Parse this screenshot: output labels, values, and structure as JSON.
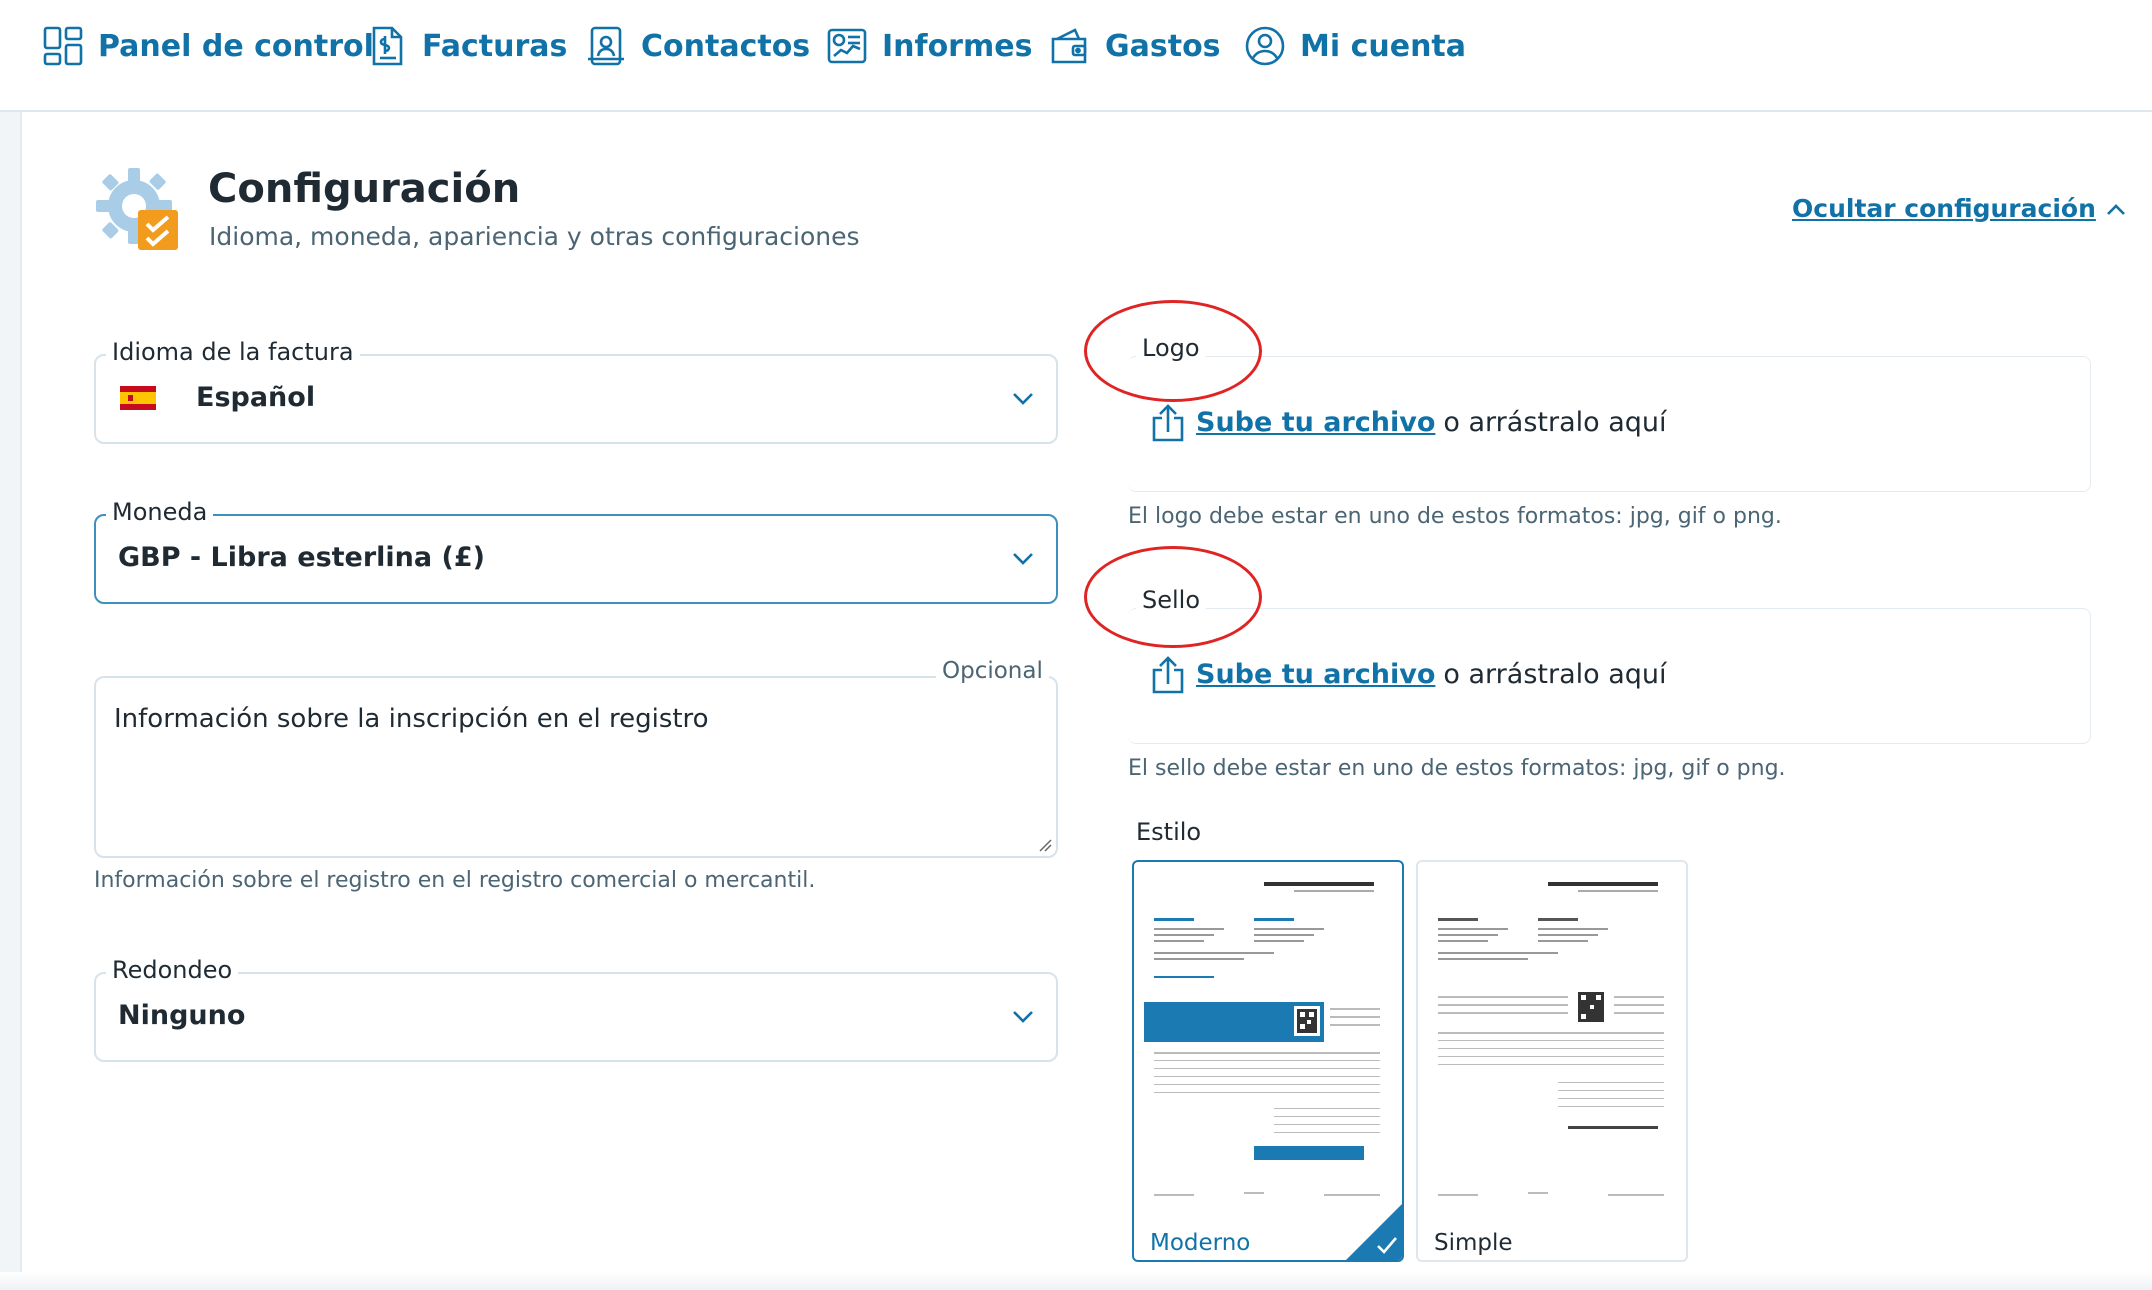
{
  "nav": {
    "items": [
      {
        "label": "Panel de control",
        "icon": "dashboard-icon"
      },
      {
        "label": "Facturas",
        "icon": "invoice-icon"
      },
      {
        "label": "Contactos",
        "icon": "contacts-icon"
      },
      {
        "label": "Informes",
        "icon": "reports-icon"
      },
      {
        "label": "Gastos",
        "icon": "wallet-icon"
      },
      {
        "label": "Mi cuenta",
        "icon": "user-circle-icon"
      }
    ]
  },
  "header": {
    "title": "Configuración",
    "subtitle": "Idioma, moneda, apariencia y otras configuraciones",
    "hide_label": "Ocultar configuración"
  },
  "form": {
    "language": {
      "label": "Idioma de la factura",
      "value": "Español"
    },
    "currency": {
      "label": "Moneda",
      "value": "GBP - Libra esterlina (£)"
    },
    "registry": {
      "optional": "Opcional",
      "placeholder": "Información sobre la inscripción en el registro",
      "help": "Información sobre el registro en el registro comercial o mercantil."
    },
    "rounding": {
      "label": "Redondeo",
      "value": "Ninguno"
    }
  },
  "uploads": {
    "logo": {
      "label": "Logo",
      "link": "Sube tu archivo",
      "rest": "o arrástralo aquí",
      "help": "El logo debe estar en uno de estos formatos: jpg, gif o png."
    },
    "stamp": {
      "label": "Sello",
      "link": "Sube tu archivo",
      "rest": "o arrástralo aquí",
      "help": "El sello debe estar en uno de estos formatos: jpg, gif o png."
    }
  },
  "style": {
    "label": "Estilo",
    "options": [
      {
        "name": "Moderno",
        "selected": true
      },
      {
        "name": "Simple",
        "selected": false
      }
    ]
  },
  "colors": {
    "accent": "#1172a8",
    "annotation": "#e02424",
    "border": "#d7e3ea"
  }
}
